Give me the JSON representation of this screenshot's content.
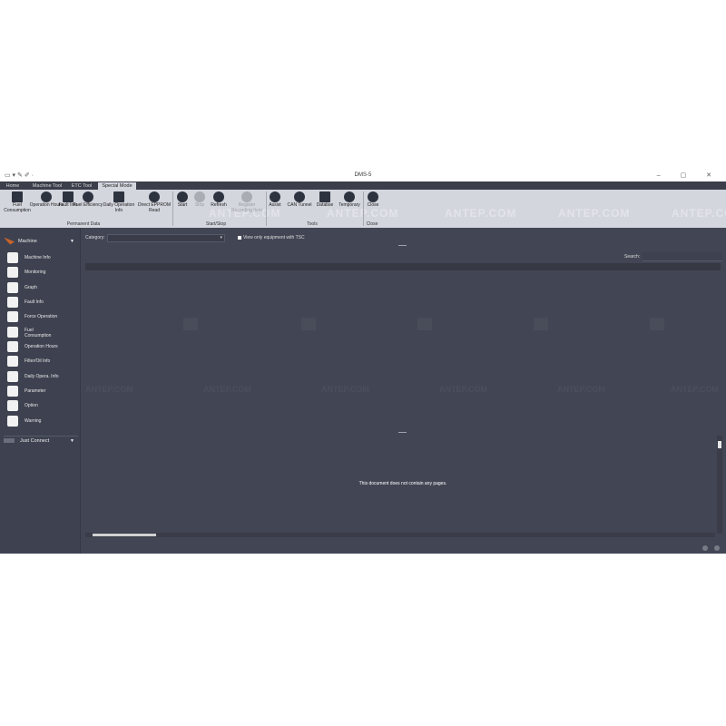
{
  "window": {
    "title": "DMS-5",
    "quick_access": "▭ ▾  ✎  ✐  ·",
    "controls": "–  ▢  ✕"
  },
  "tabs": [
    "Home",
    "Machine Tool",
    "ETC Tool",
    "Special Mode"
  ],
  "ribbon": {
    "permanent_data": {
      "label": "Permanent Data",
      "buttons": [
        "Fuel Consumption",
        "Operation Hours",
        "Fault Info",
        "Fuel Efficiency",
        "Daily Operation Info",
        "Direct EPPROM Read"
      ]
    },
    "start_stop": {
      "label": "Start/Stop",
      "buttons": [
        "Start",
        "Stop",
        "Refresh",
        "Register Recording Item"
      ]
    },
    "tools": {
      "label": "Tools",
      "buttons": [
        "Assist",
        "CAN Tunnel",
        "Databse",
        "Temporary"
      ]
    },
    "close": {
      "label": "Close",
      "buttons": [
        "Close"
      ]
    },
    "watermark": "ANTEP.COM"
  },
  "sidebar": {
    "header": "Machine",
    "items": [
      "Machine Info",
      "Monitoring",
      "Graph",
      "Fault Info",
      "Force Operation",
      "Fuel Consumption",
      "Operation Hours",
      "Filter/Oil Info",
      "Daily Opera. Info",
      "Parameter",
      "Option",
      "Warning"
    ],
    "just_connect": "Just Connect"
  },
  "main": {
    "category_label": "Category:",
    "category_value": "",
    "view_only_label": "View only equipment with TSC",
    "search_label": "Search:",
    "search_value": "",
    "document_message": "This document does not contain any pages."
  }
}
